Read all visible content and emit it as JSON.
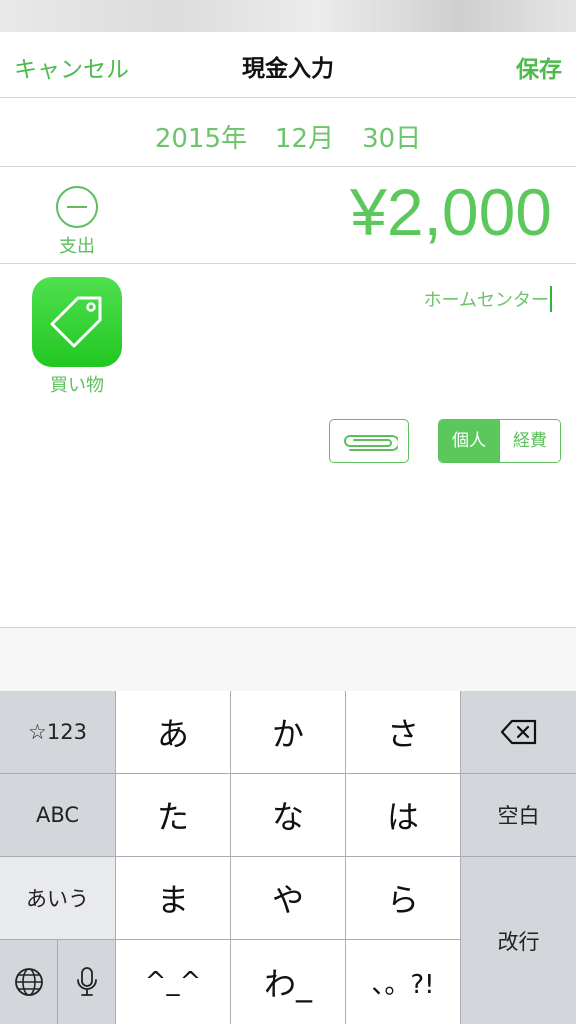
{
  "nav": {
    "cancel_label": "キャンセル",
    "title": "現金入力",
    "save_label": "保存"
  },
  "date": {
    "year": "2015年",
    "month": "12月",
    "day": "30日"
  },
  "entry": {
    "type_label": "支出",
    "amount": "¥2,000"
  },
  "category": {
    "label": "買い物",
    "icon": "price-tag-icon"
  },
  "memo": {
    "value": "ホームセンター"
  },
  "attachment": {
    "icon": "paperclip-icon"
  },
  "scope": {
    "personal_label": "個人",
    "expense_label": "経費",
    "selected": "個人"
  },
  "keyboard": {
    "mode_symbols": "☆123",
    "mode_abc": "ABC",
    "mode_kana": "あいう",
    "globe_icon": "globe-icon",
    "mic_icon": "microphone-icon",
    "keys": {
      "a": "あ",
      "ka": "か",
      "sa": "さ",
      "ta": "た",
      "na": "な",
      "ha": "は",
      "ma": "ま",
      "ya": "や",
      "ra": "ら",
      "kaomoji": "^_^",
      "wa": "わ_",
      "punct": "、。?!"
    },
    "backspace_icon": "backspace-icon",
    "space_label": "空白",
    "return_label": "改行"
  },
  "colors": {
    "accent": "#5cc85c",
    "category_icon": "#2ccb2c",
    "keyboard_bg": "#d3d6db"
  }
}
